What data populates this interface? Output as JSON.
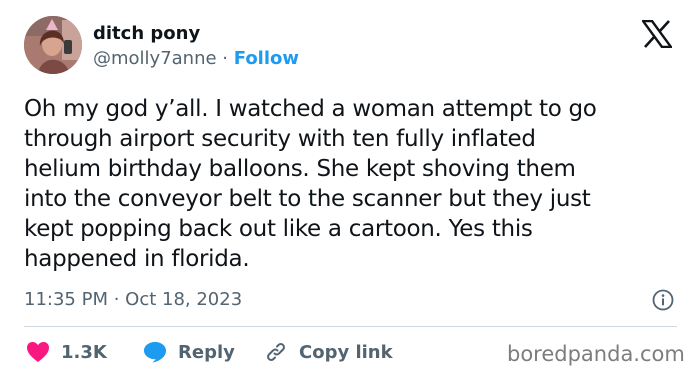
{
  "author": {
    "display_name": "ditch pony",
    "handle": "@molly7anne",
    "separator": " · ",
    "follow_label": "Follow"
  },
  "tweet": {
    "lines": [
      "Oh my god y’all. I watched a woman attempt to go",
      "through airport security with ten fully inflated",
      "helium birthday balloons. She kept shoving them",
      "into the conveyor belt to the scanner but they just",
      "kept popping back out like a cartoon. Yes this",
      "happened in florida."
    ],
    "time": "11:35 PM",
    "time_separator": " · ",
    "date": "Oct 18, 2023"
  },
  "actions": {
    "like_count": "1.3K",
    "reply_label": "Reply",
    "copy_link_label": "Copy link"
  },
  "icons": {
    "brand": "x-logo-icon",
    "info": "info-icon",
    "like": "heart-icon",
    "reply": "speech-bubble-icon",
    "copy": "link-icon"
  },
  "colors": {
    "text": "#0f1419",
    "secondary_text": "#536471",
    "accent": "#1d9bf0",
    "like": "#f91880",
    "divider": "#cfd9de"
  },
  "watermark": "boredpanda.com"
}
